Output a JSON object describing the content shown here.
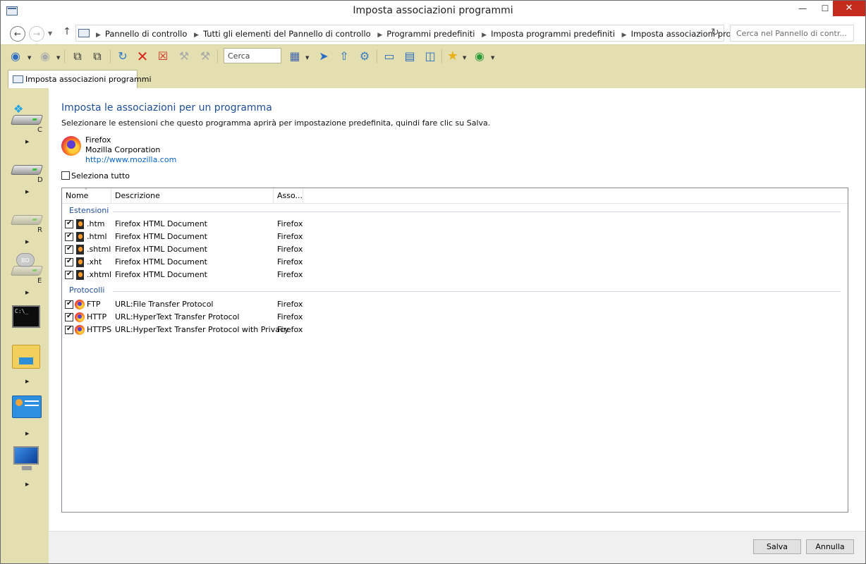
{
  "window": {
    "title": "Imposta associazioni programmi",
    "minimize_glyph": "—",
    "maximize_glyph": "☐",
    "close_glyph": "✕"
  },
  "address": {
    "breadcrumbs": [
      "Pannello di controllo",
      "Tutti gli elementi del Pannello di controllo",
      "Programmi predefiniti",
      "Imposta programmi predefiniti",
      "Imposta associazioni programmi"
    ],
    "search_placeholder": "Cerca nel Pannello di contr..."
  },
  "toolbar": {
    "search_placeholder": "Cerca"
  },
  "tab": {
    "label": "Imposta associazioni programmi"
  },
  "sidebar": {
    "drive_letters": [
      "C",
      "D",
      "R",
      "E"
    ],
    "bd_label": "BD",
    "console_text": "C:\\_"
  },
  "content": {
    "heading": "Imposta le associazioni per un programma",
    "instruction": "Selezionare le estensioni che questo programma aprirà per impostazione predefinita, quindi fare clic su Salva.",
    "program": {
      "name": "Firefox",
      "publisher": "Mozilla Corporation",
      "url": "http://www.mozilla.com"
    },
    "select_all_label": "Seleziona tutto",
    "columns": [
      "Nome",
      "Descrizione",
      "Asso..."
    ],
    "groups": {
      "extensions": {
        "title": "Estensioni",
        "rows": [
          {
            "name": ".htm",
            "description": "Firefox HTML Document",
            "assoc": "Firefox",
            "checked": true
          },
          {
            "name": ".html",
            "description": "Firefox HTML Document",
            "assoc": "Firefox",
            "checked": true
          },
          {
            "name": ".shtml",
            "description": "Firefox HTML Document",
            "assoc": "Firefox",
            "checked": true
          },
          {
            "name": ".xht",
            "description": "Firefox HTML Document",
            "assoc": "Firefox",
            "checked": true
          },
          {
            "name": ".xhtml",
            "description": "Firefox HTML Document",
            "assoc": "Firefox",
            "checked": true
          }
        ]
      },
      "protocols": {
        "title": "Protocolli",
        "rows": [
          {
            "name": "FTP",
            "description": "URL:File Transfer Protocol",
            "assoc": "Firefox",
            "checked": true
          },
          {
            "name": "HTTP",
            "description": "URL:HyperText Transfer Protocol",
            "assoc": "Firefox",
            "checked": true
          },
          {
            "name": "HTTPS",
            "description": "URL:HyperText Transfer Protocol with Privacy",
            "assoc": "Firefox",
            "checked": true
          }
        ]
      }
    }
  },
  "buttons": {
    "save": "Salva",
    "cancel": "Annulla"
  },
  "colors": {
    "accent_heading": "#1f4e9a",
    "link": "#0a64c8",
    "chrome_bg": "#e3dfb0",
    "close_button": "#c42b1c"
  }
}
